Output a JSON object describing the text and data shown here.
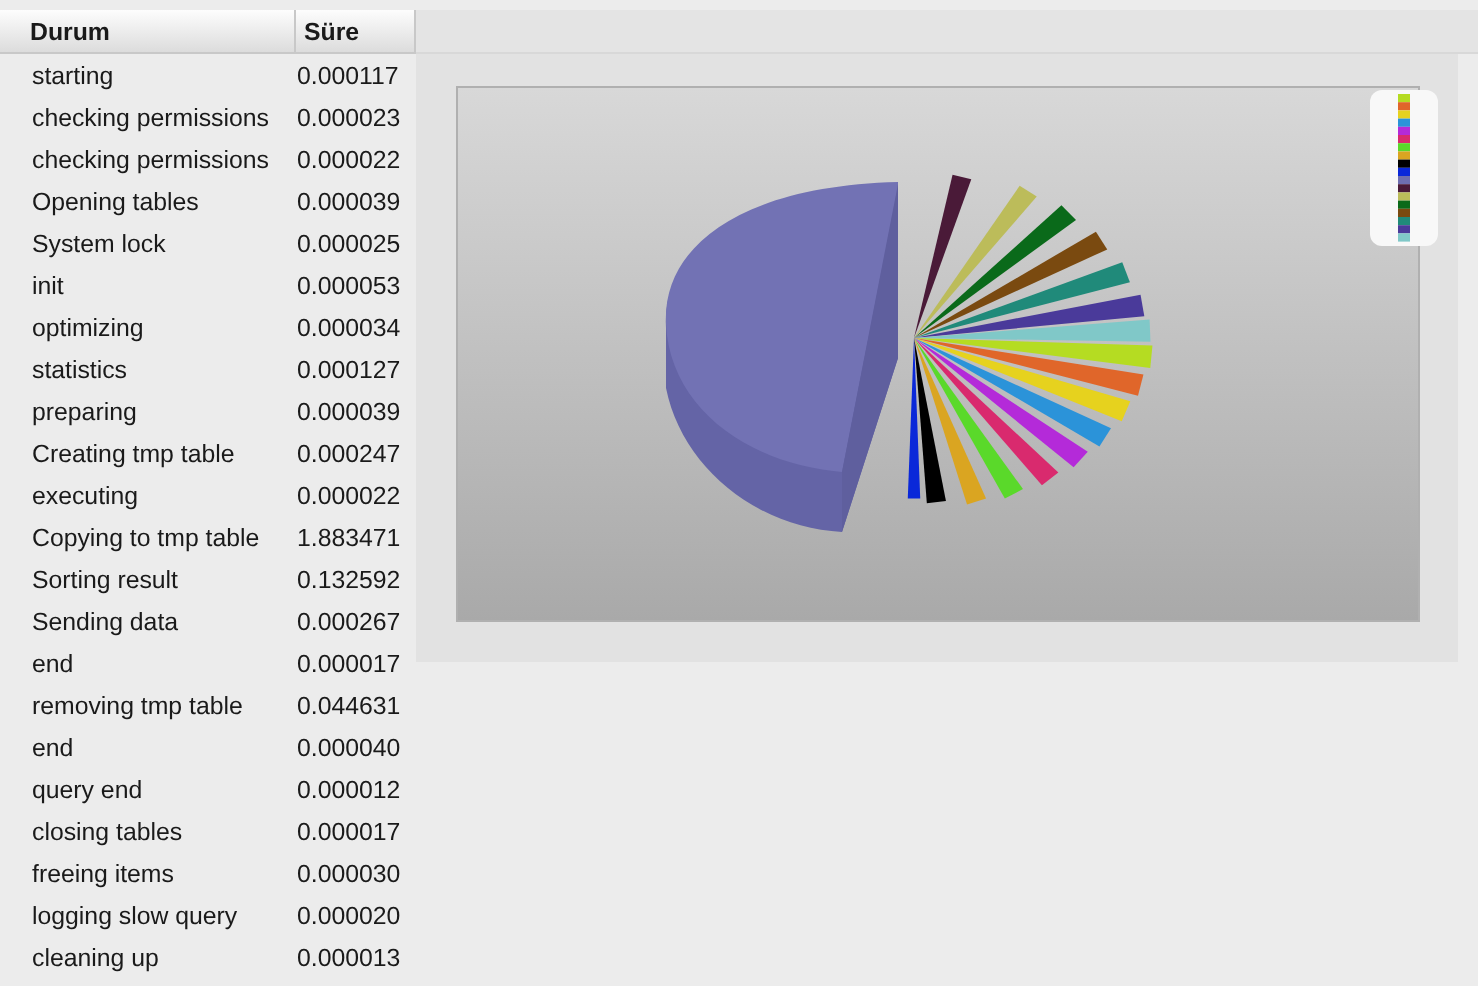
{
  "table": {
    "columns": [
      "Durum",
      "Süre"
    ],
    "rows": [
      {
        "durum": "starting",
        "sure": "0.000117"
      },
      {
        "durum": "checking permissions",
        "sure": "0.000023"
      },
      {
        "durum": "checking permissions",
        "sure": "0.000022"
      },
      {
        "durum": "Opening tables",
        "sure": "0.000039"
      },
      {
        "durum": "System lock",
        "sure": "0.000025"
      },
      {
        "durum": "init",
        "sure": "0.000053"
      },
      {
        "durum": "optimizing",
        "sure": "0.000034"
      },
      {
        "durum": "statistics",
        "sure": "0.000127"
      },
      {
        "durum": "preparing",
        "sure": "0.000039"
      },
      {
        "durum": "Creating tmp table",
        "sure": "0.000247"
      },
      {
        "durum": "executing",
        "sure": "0.000022"
      },
      {
        "durum": "Copying to tmp table",
        "sure": "1.883471"
      },
      {
        "durum": "Sorting result",
        "sure": "0.132592"
      },
      {
        "durum": "Sending data",
        "sure": "0.000267"
      },
      {
        "durum": "end",
        "sure": "0.000017"
      },
      {
        "durum": "removing tmp table",
        "sure": "0.044631"
      },
      {
        "durum": "end",
        "sure": "0.000040"
      },
      {
        "durum": "query end",
        "sure": "0.000012"
      },
      {
        "durum": "closing tables",
        "sure": "0.000017"
      },
      {
        "durum": "freeing items",
        "sure": "0.000030"
      },
      {
        "durum": "logging slow query",
        "sure": "0.000020"
      },
      {
        "durum": "cleaning up",
        "sure": "0.000013"
      }
    ]
  }
}
